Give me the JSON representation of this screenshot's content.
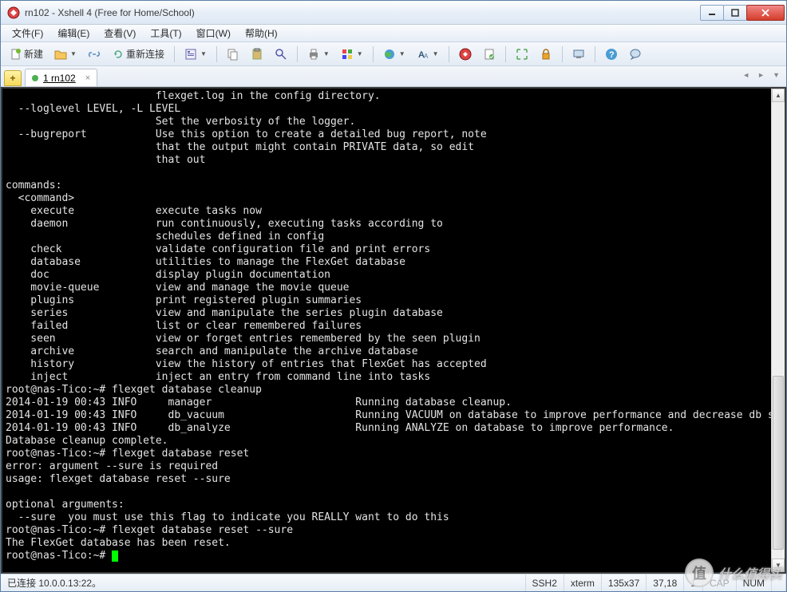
{
  "window": {
    "title": "rn102 - Xshell 4 (Free for Home/School)"
  },
  "menu": {
    "file": "文件(F)",
    "edit": "编辑(E)",
    "view": "查看(V)",
    "tools": "工具(T)",
    "window": "窗口(W)",
    "help": "帮助(H)"
  },
  "toolbar": {
    "new": "新建",
    "reconnect": "重新连接"
  },
  "tab": {
    "label": "1 rn102"
  },
  "terminal": {
    "lines": [
      "                        flexget.log in the config directory.",
      "  --loglevel LEVEL, -L LEVEL",
      "                        Set the verbosity of the logger.",
      "  --bugreport           Use this option to create a detailed bug report, note",
      "                        that the output might contain PRIVATE data, so edit",
      "                        that out",
      "",
      "commands:",
      "  <command>",
      "    execute             execute tasks now",
      "    daemon              run continuously, executing tasks according to",
      "                        schedules defined in config",
      "    check               validate configuration file and print errors",
      "    database            utilities to manage the FlexGet database",
      "    doc                 display plugin documentation",
      "    movie-queue         view and manage the movie queue",
      "    plugins             print registered plugin summaries",
      "    series              view and manipulate the series plugin database",
      "    failed              list or clear remembered failures",
      "    seen                view or forget entries remembered by the seen plugin",
      "    archive             search and manipulate the archive database",
      "    history             view the history of entries that FlexGet has accepted",
      "    inject              inject an entry from command line into tasks",
      "root@nas-Tico:~# flexget database cleanup",
      "2014-01-19 00:43 INFO     manager                       Running database cleanup.",
      "2014-01-19 00:43 INFO     db_vacuum                     Running VACUUM on database to improve performance and decrease db size.",
      "2014-01-19 00:43 INFO     db_analyze                    Running ANALYZE on database to improve performance.",
      "Database cleanup complete.",
      "root@nas-Tico:~# flexget database reset",
      "error: argument --sure is required",
      "usage: flexget database reset --sure",
      "",
      "optional arguments:",
      "  --sure  you must use this flag to indicate you REALLY want to do this",
      "root@nas-Tico:~# flexget database reset --sure",
      "The FlexGet database has been reset.",
      "root@nas-Tico:~# "
    ]
  },
  "status": {
    "connection": "已连接 10.0.0.13:22。",
    "protocol": "SSH2",
    "termtype": "xterm",
    "size": "135x37",
    "cursor": "37,18",
    "session": "1",
    "cap": "CAP",
    "num": "NUM"
  },
  "watermark": {
    "text": "什么值得买"
  }
}
